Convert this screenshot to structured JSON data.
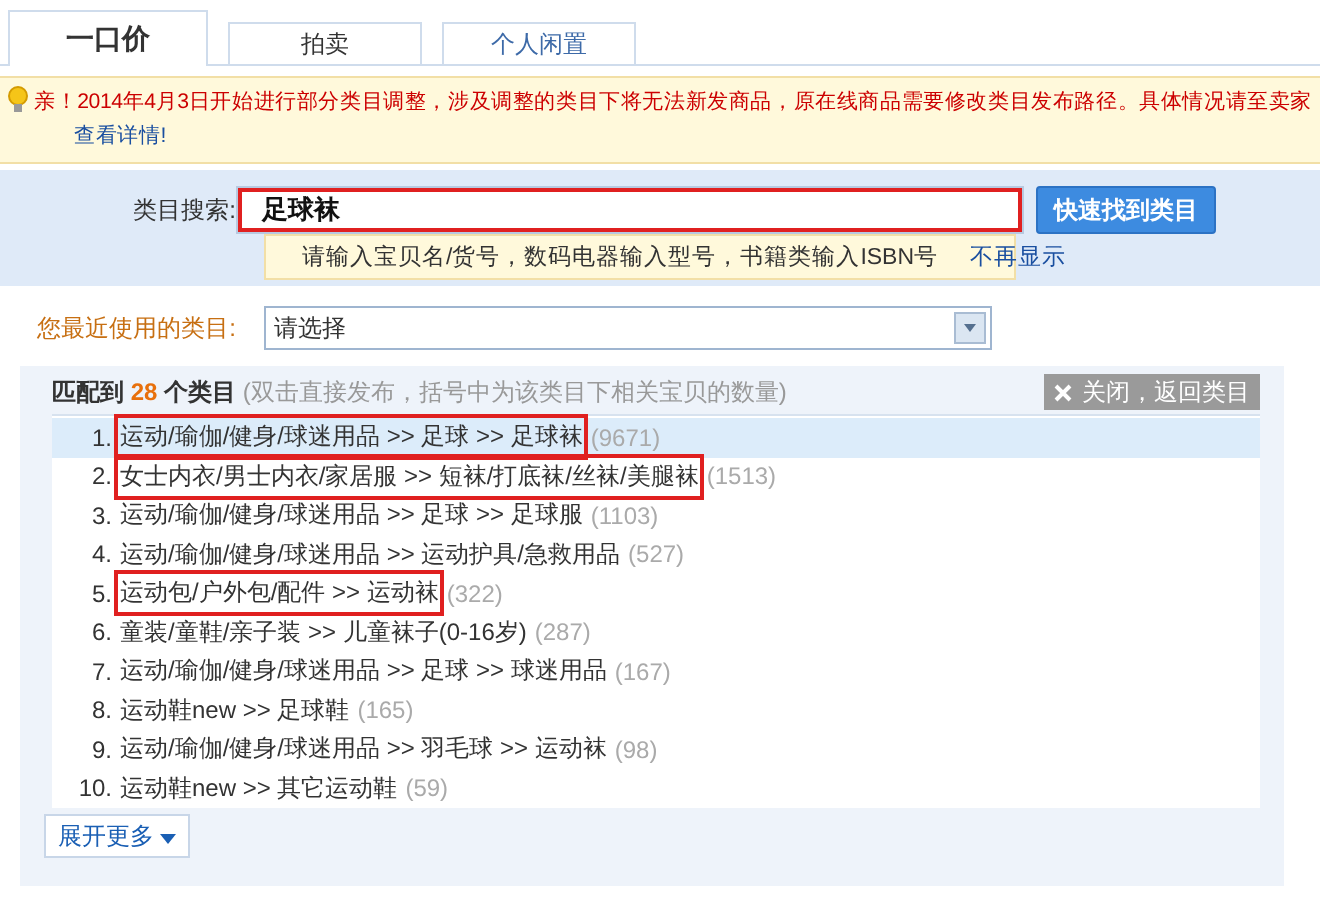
{
  "tabs": [
    {
      "label": "一口价",
      "selected": true
    },
    {
      "label": "拍卖",
      "selected": false
    },
    {
      "label": "个人闲置",
      "selected": false
    }
  ],
  "notice": {
    "text": "亲！2014年4月3日开始进行部分类目调整，涉及调整的类目下将无法新发商品，原在线商品需要修改类目发布路径。具体情况请至卖家",
    "link": "查看详情!"
  },
  "search": {
    "label": "类目搜索:",
    "value": "足球袜",
    "highlighted": true,
    "button": "快速找到类目",
    "hint": "请输入宝贝名/货号，数码电器输入型号，书籍类输入ISBN号",
    "dismiss": "不再显示"
  },
  "recent": {
    "label": "您最近使用的类目:",
    "value": "请选择"
  },
  "results": {
    "prefix": "匹配到",
    "count": "28",
    "unit": "个类目",
    "note": "(双击直接发布，括号中为该类目下相关宝贝的数量)",
    "close_button": "关闭，返回类目",
    "expand_button": "展开更多",
    "rows": [
      {
        "number": "1.",
        "path": "运动/瑜伽/健身/球迷用品 >> 足球 >> 足球袜",
        "count": "(9671)",
        "selected": true,
        "highlighted": true
      },
      {
        "number": "2.",
        "path": "女士内衣/男士内衣/家居服 >> 短袜/打底袜/丝袜/美腿袜",
        "count": "(1513)",
        "selected": false,
        "highlighted": true
      },
      {
        "number": "3.",
        "path": "运动/瑜伽/健身/球迷用品 >> 足球 >> 足球服",
        "count": "(1103)",
        "selected": false,
        "highlighted": false
      },
      {
        "number": "4.",
        "path": "运动/瑜伽/健身/球迷用品 >> 运动护具/急救用品",
        "count": "(527)",
        "selected": false,
        "highlighted": false
      },
      {
        "number": "5.",
        "path": "运动包/户外包/配件 >> 运动袜",
        "count": "(322)",
        "selected": false,
        "highlighted": true
      },
      {
        "number": "6.",
        "path": "童装/童鞋/亲子装 >> 儿童袜子(0-16岁)",
        "count": "(287)",
        "selected": false,
        "highlighted": false
      },
      {
        "number": "7.",
        "path": "运动/瑜伽/健身/球迷用品 >> 足球 >> 球迷用品",
        "count": "(167)",
        "selected": false,
        "highlighted": false
      },
      {
        "number": "8.",
        "path": "运动鞋new >> 足球鞋",
        "count": "(165)",
        "selected": false,
        "highlighted": false
      },
      {
        "number": "9.",
        "path": "运动/瑜伽/健身/球迷用品 >> 羽毛球 >> 运动袜",
        "count": "(98)",
        "selected": false,
        "highlighted": false
      },
      {
        "number": "10.",
        "path": "运动鞋new >> 其它运动鞋",
        "count": "(59)",
        "selected": false,
        "highlighted": false
      }
    ]
  }
}
